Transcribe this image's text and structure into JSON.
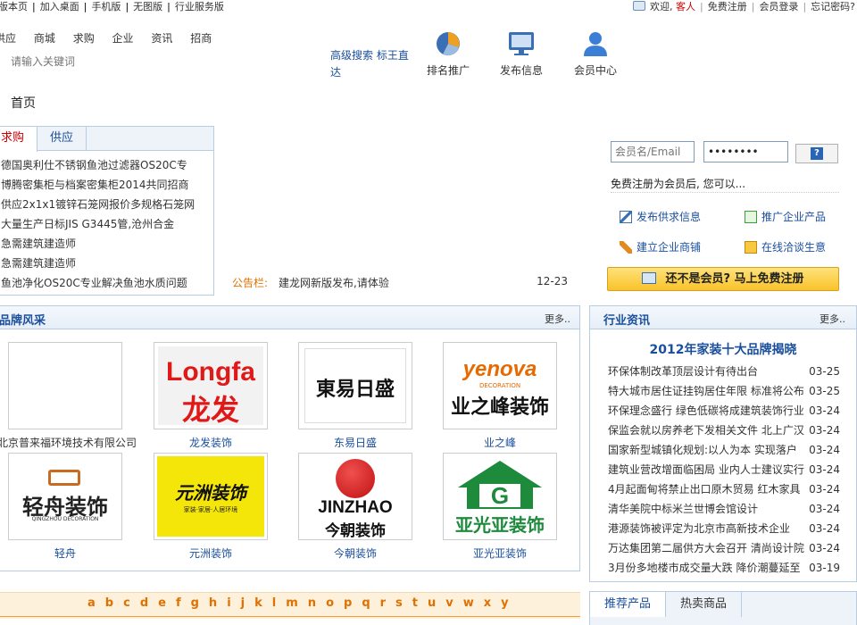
{
  "topbar": {
    "links": [
      "版本页",
      "加入桌面",
      "手机版",
      "无图版",
      "行业服务版"
    ],
    "welcome": "欢迎,",
    "guest": "客人",
    "right_links": [
      "免费注册",
      "会员登录",
      "忘记密码?"
    ]
  },
  "nav": {
    "items": [
      "供应",
      "商城",
      "求购",
      "企业",
      "资讯",
      "招商"
    ]
  },
  "search": {
    "placeholder": "请输入关键词",
    "advanced": "高级搜索 标王直达"
  },
  "header_icons": [
    {
      "label": "排名推广",
      "icon": "ranking-pie-icon"
    },
    {
      "label": "发布信息",
      "icon": "monitor-icon"
    },
    {
      "label": "会员中心",
      "icon": "user-icon"
    }
  ],
  "breadcrumb": "首页",
  "tabs": {
    "items": [
      "求购",
      "供应"
    ],
    "list": [
      "德国奥利仕不锈钢鱼池过滤器OS20C专",
      "博腾密集柜与档案密集柜2014共同招商",
      "供应2x1x1镀锌石笼网报价多规格石笼网",
      "大量生产日标JIS G3445管,沧州合金",
      "急需建筑建造师",
      "急需建筑建造师",
      "鱼池净化OS20C专业解决鱼池水质问题"
    ]
  },
  "notice": {
    "label": "公告栏:",
    "text": "建龙网新版发布,请体验",
    "date": "12-23"
  },
  "brand": {
    "title": "品牌风采",
    "more": "更多..",
    "items": [
      {
        "name": "北京普来福环境技术有限公司",
        "logo": "blank"
      },
      {
        "name": "龙发装饰",
        "logo": "longfa",
        "text1": "Longfa",
        "text2": "龙发"
      },
      {
        "name": "东易日盛",
        "logo": "dongyi",
        "text1": "東易日盛"
      },
      {
        "name": "业之峰",
        "logo": "yenova",
        "text1": "yenova",
        "text2": "DECORATION",
        "text3": "业之峰装饰"
      },
      {
        "name": "轻舟",
        "logo": "qingzhou",
        "text1": "轻舟装饰",
        "text2": "QINGZHOU DECORATION"
      },
      {
        "name": "元洲装饰",
        "logo": "yuanzhou",
        "text1": "元洲装饰",
        "text2": "家装·家居·人居环境"
      },
      {
        "name": "今朝装饰",
        "logo": "jinzhao",
        "text1": "JINZHAO",
        "text2": "今朝装饰"
      },
      {
        "name": "亚光亚装饰",
        "logo": "yaguangya",
        "text1": "亚光亚装饰"
      }
    ]
  },
  "letters": [
    "a",
    "b",
    "c",
    "d",
    "e",
    "f",
    "g",
    "h",
    "i",
    "j",
    "k",
    "l",
    "m",
    "n",
    "o",
    "p",
    "q",
    "r",
    "s",
    "t",
    "u",
    "v",
    "w",
    "x",
    "y"
  ],
  "login": {
    "user_placeholder": "会员名/Email",
    "password_value": "••••••••",
    "tip": "免费注册为会员后, 您可以...",
    "services": [
      "发布供求信息",
      "推广企业产品",
      "建立企业商铺",
      "在线洽谈生意"
    ],
    "register": "还不是会员? 马上免费注册"
  },
  "news": {
    "title": "行业资讯",
    "more": "更多..",
    "headline": "2012年家装十大品牌揭晓",
    "items": [
      {
        "text": "环保体制改革顶层设计有待出台",
        "date": "03-25"
      },
      {
        "text": "特大城市居住证挂钩居住年限 标准将公布",
        "date": "03-25"
      },
      {
        "text": "环保理念盛行 绿色低碳将成建筑装饰行业",
        "date": "03-24"
      },
      {
        "text": "保监会就以房养老下发相关文件 北上广汉",
        "date": "03-24"
      },
      {
        "text": "国家新型城镇化规划:以人为本 实现落户",
        "date": "03-24"
      },
      {
        "text": "建筑业营改增面临困局 业内人士建议实行",
        "date": "03-24"
      },
      {
        "text": "4月起面甸将禁止出口原木贸易 红木家具",
        "date": "03-24"
      },
      {
        "text": "清华美院中标米兰世博会馆设计",
        "date": "03-24"
      },
      {
        "text": "港源装饰被评定为北京市高新技术企业",
        "date": "03-24"
      },
      {
        "text": "万达集团第二届供方大会召开 清尚设计院",
        "date": "03-24"
      },
      {
        "text": "3月份多地楼市成交量大跌 降价潮蔓延至",
        "date": "03-19"
      }
    ]
  },
  "products": {
    "tabs": [
      "推荐产品",
      "热卖商品"
    ]
  }
}
